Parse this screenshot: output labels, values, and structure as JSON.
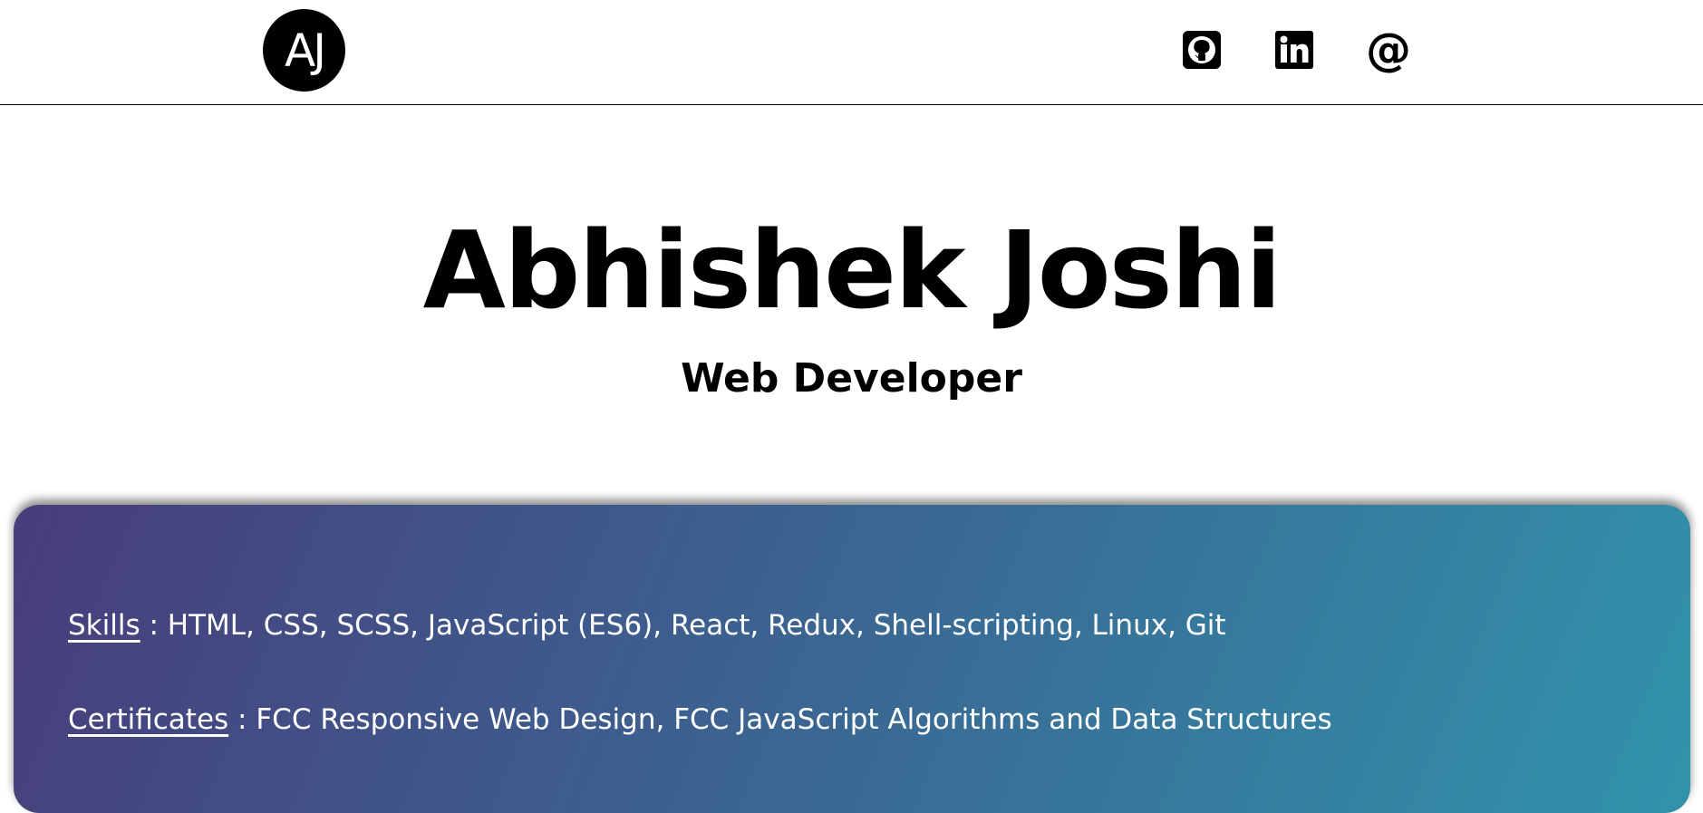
{
  "header": {
    "logo_text": "AJ",
    "social": [
      {
        "name": "github",
        "icon": "github-icon"
      },
      {
        "name": "linkedin",
        "icon": "linkedin-icon",
        "text": "in"
      },
      {
        "name": "email",
        "icon": "at-icon",
        "text": "@"
      }
    ]
  },
  "hero": {
    "name": "Abhishek Joshi",
    "role": "Web Developer"
  },
  "info": {
    "skills_label": "Skills",
    "skills_value": " : HTML, CSS, SCSS, JavaScript (ES6), React, Redux, Shell-scripting, Linux, Git",
    "certs_label": "Certificates",
    "certs_value": " : FCC Responsive Web Design, FCC JavaScript Algorithms and Data Structures"
  },
  "colors": {
    "gradient_start": "#483d7b",
    "gradient_end": "#3193ab",
    "text_dark": "#000000",
    "text_light": "#ffffff"
  }
}
